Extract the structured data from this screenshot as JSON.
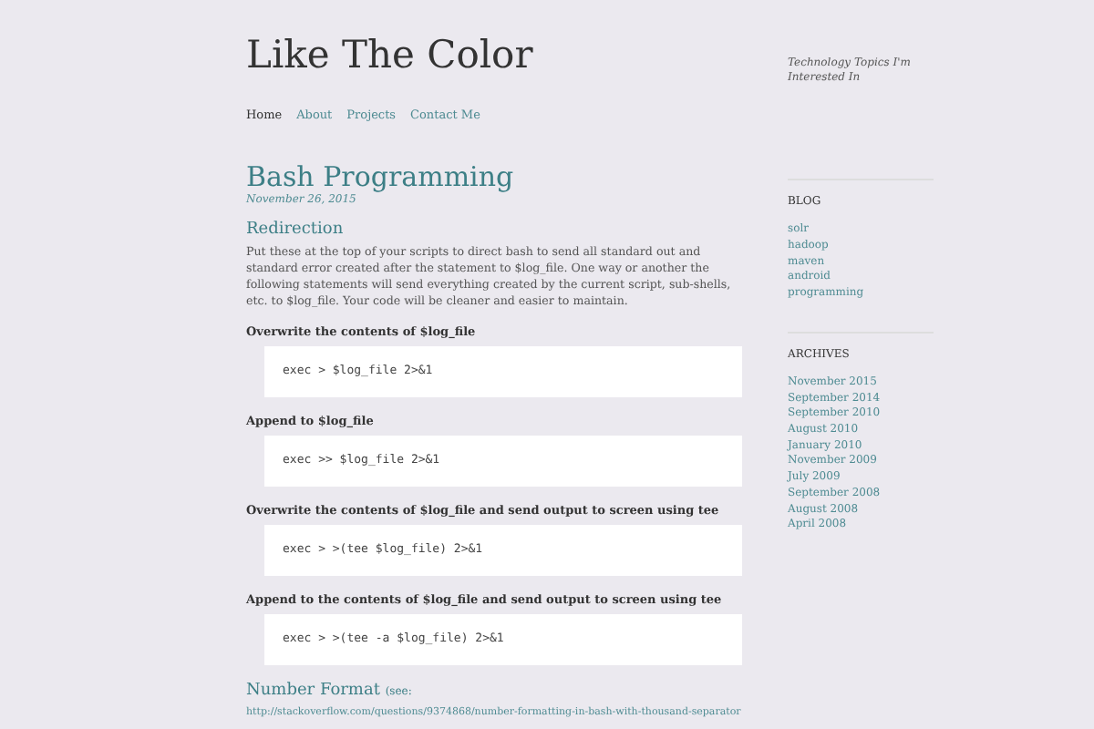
{
  "site": {
    "title": "Like The Color",
    "tagline": "Technology Topics I'm Interested In"
  },
  "nav": [
    {
      "label": "Home",
      "selected": true
    },
    {
      "label": "About",
      "selected": false
    },
    {
      "label": "Projects",
      "selected": false
    },
    {
      "label": "Contact Me",
      "selected": false
    }
  ],
  "post": {
    "title": "Bash Programming",
    "date": "November 26, 2015",
    "sections": [
      {
        "heading": "Redirection",
        "intro": "Put these at the top of your scripts to direct bash to send all standard out and standard error created after the statement  to $log_file.  One way or another the following statements will send everything created by the current script, sub-shells, etc. to $log_file.  Your code will be cleaner and easier to maintain.",
        "examples": [
          {
            "label": "Overwrite the contents of $log_file",
            "code": "exec > $log_file 2>&1"
          },
          {
            "label": "Append to $log_file",
            "code": "exec >> $log_file 2>&1"
          },
          {
            "label": "Overwrite the contents of $log_file and send output to screen using tee",
            "code": "exec > >(tee $log_file) 2>&1"
          },
          {
            "label": "Append to the contents of $log_file and send output to screen using tee",
            "code": "exec > >(tee -a $log_file) 2>&1"
          }
        ]
      },
      {
        "heading": "Number Format",
        "note": "(see:",
        "link": "http://stackoverflow.com/questions/9374868/number-formatting-in-bash-with-thousand-separator"
      }
    ]
  },
  "sidebar": [
    {
      "title": "BLOG",
      "links": [
        "solr",
        "hadoop",
        "maven",
        "android",
        "programming"
      ]
    },
    {
      "title": "ARCHIVES",
      "links": [
        "November 2015",
        "September 2014",
        "September 2010",
        "August 2010",
        "January 2010",
        "November 2009",
        "July 2009",
        "September 2008",
        "August 2008",
        "April 2008"
      ]
    }
  ]
}
